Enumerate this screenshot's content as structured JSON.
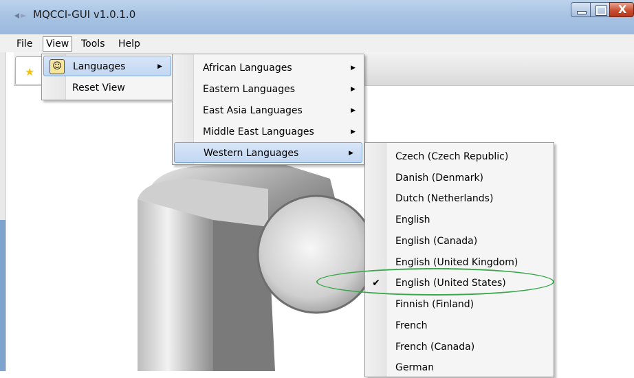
{
  "window": {
    "title": "MQCCI-GUI v1.0.1.0",
    "close_glyph": "X"
  },
  "menubar": {
    "items": [
      "File",
      "View",
      "Tools",
      "Help"
    ]
  },
  "view_menu": {
    "items": [
      {
        "label": "Languages",
        "has_submenu": true
      },
      {
        "label": "Reset View",
        "has_submenu": false
      }
    ]
  },
  "languages_menu": {
    "items": [
      {
        "label": "African Languages"
      },
      {
        "label": "Eastern Languages"
      },
      {
        "label": "East Asia Languages"
      },
      {
        "label": "Middle East Languages"
      },
      {
        "label": "Western Languages"
      }
    ]
  },
  "western_menu": {
    "checked": "English (United States)",
    "items": [
      {
        "label": "Czech (Czech Republic)"
      },
      {
        "label": "Danish (Denmark)"
      },
      {
        "label": "Dutch (Netherlands)"
      },
      {
        "label": "English"
      },
      {
        "label": "English (Canada)"
      },
      {
        "label": "English (United Kingdom)"
      },
      {
        "label": "English (United States)"
      },
      {
        "label": "Finnish (Finland)"
      },
      {
        "label": "French"
      },
      {
        "label": "French (Canada)"
      },
      {
        "label": "German"
      }
    ]
  },
  "icons": {
    "submenu_arrow": "▶",
    "check": "✔",
    "languages": "face-icon",
    "toolbar_new": "new-star-icon"
  },
  "colors": {
    "highlight": "#c2d7f2",
    "annotation": "#39a84a"
  }
}
